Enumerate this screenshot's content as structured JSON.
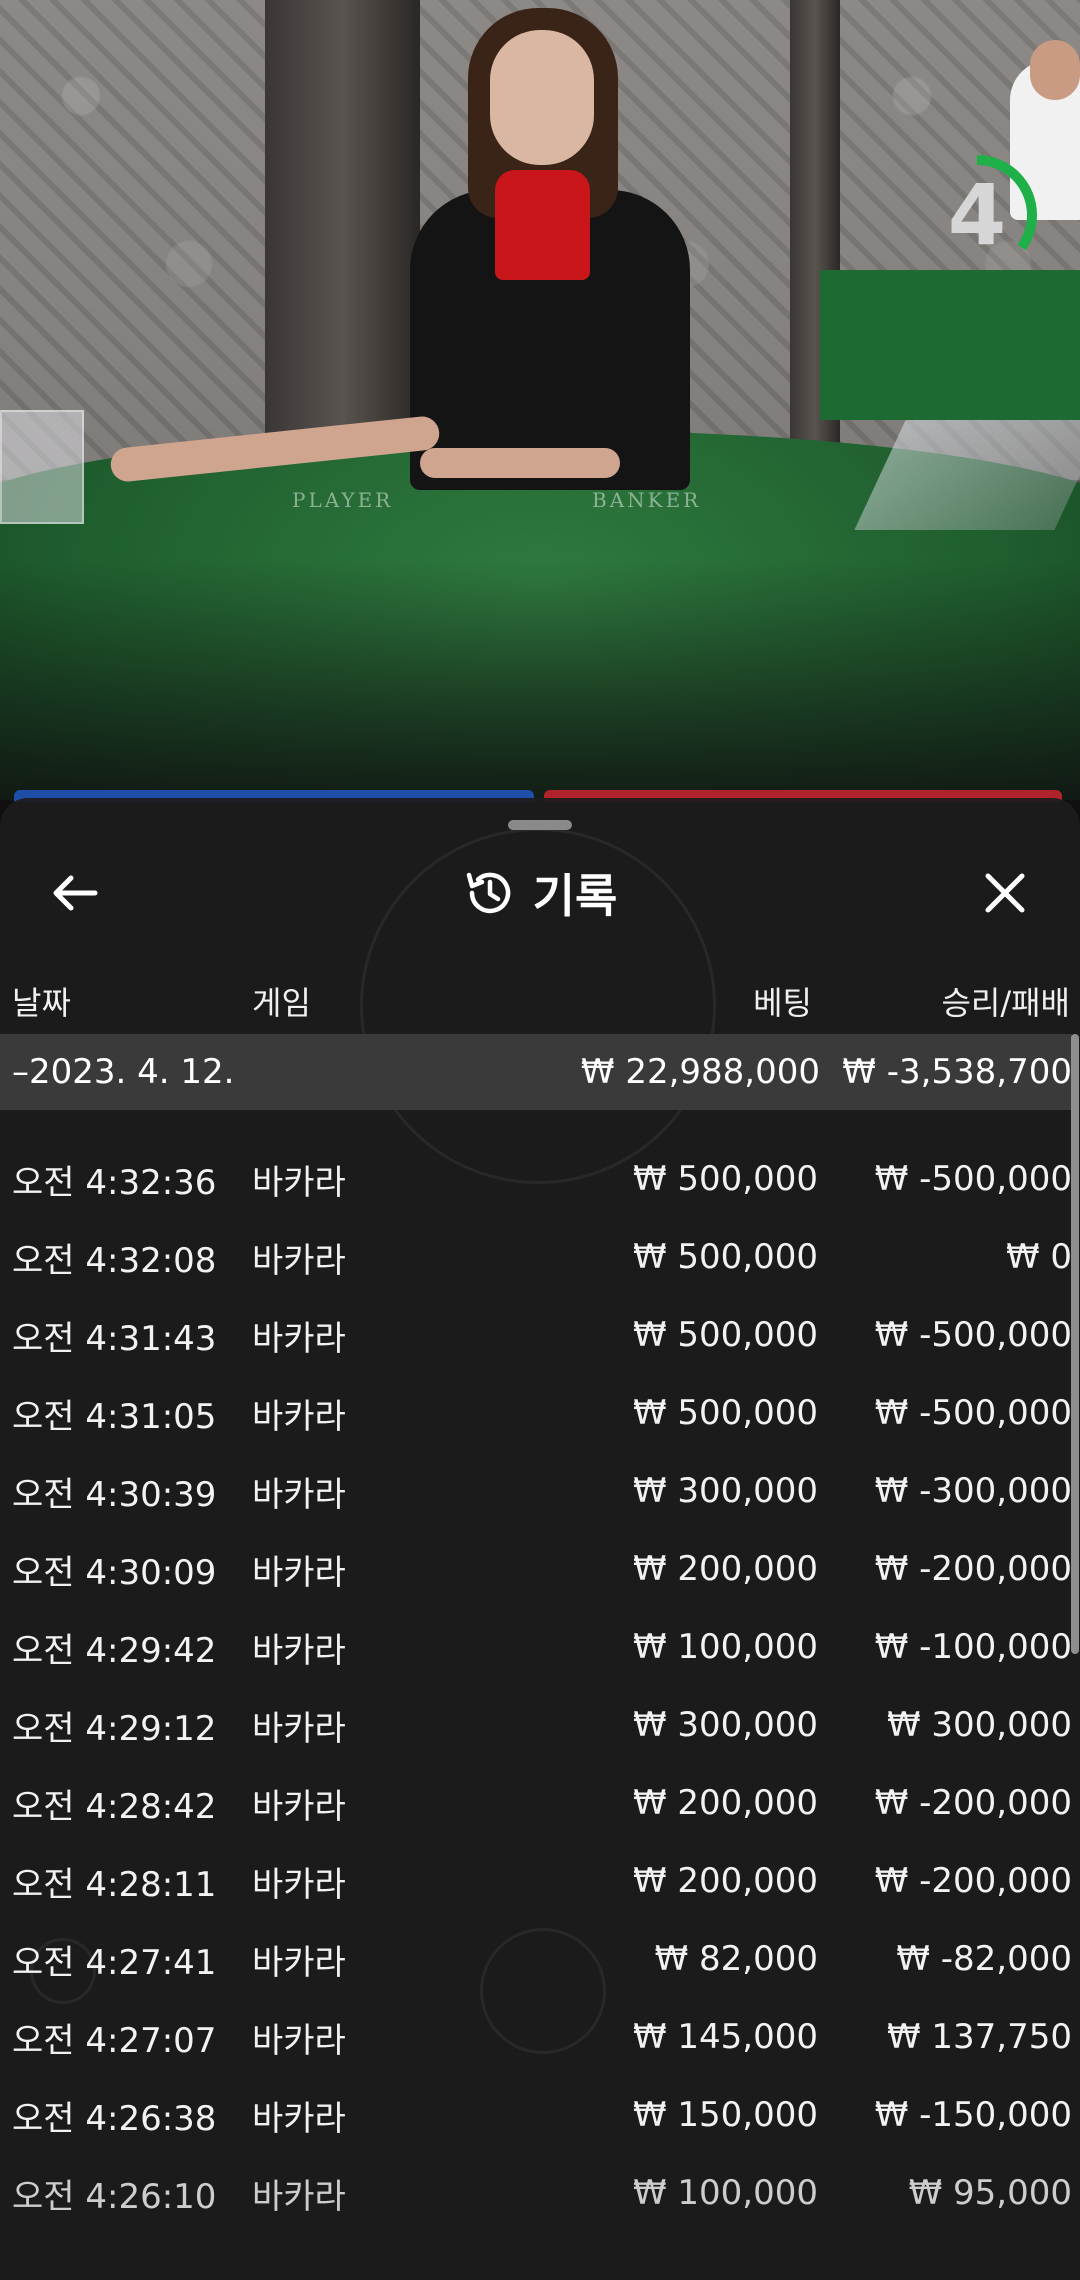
{
  "timer": {
    "value": "4",
    "progress": 0.35,
    "color": "#1fb04a"
  },
  "table": {
    "player_label": "PLAYER",
    "banker_label": "BANKER"
  },
  "colors": {
    "player": "#1e4ea8",
    "banker": "#b0232b",
    "summary_bg": "#3a3a3a"
  },
  "header": {
    "back_icon": "arrow-left-icon",
    "history_icon": "history-clock-icon",
    "title": "기록",
    "close_icon": "close-x-icon"
  },
  "columns": {
    "date": "날짜",
    "game": "게임",
    "bet": "베팅",
    "result": "승리/패배"
  },
  "summary": {
    "date": "–2023. 4. 12.",
    "bet": "₩ 22,988,000",
    "result": "₩ -3,538,700"
  },
  "rows": [
    {
      "time": "오전 4:32:36",
      "game": "바카라",
      "bet": "₩ 500,000",
      "result": "₩ -500,000"
    },
    {
      "time": "오전 4:32:08",
      "game": "바카라",
      "bet": "₩ 500,000",
      "result": "₩ 0"
    },
    {
      "time": "오전 4:31:43",
      "game": "바카라",
      "bet": "₩ 500,000",
      "result": "₩ -500,000"
    },
    {
      "time": "오전 4:31:05",
      "game": "바카라",
      "bet": "₩ 500,000",
      "result": "₩ -500,000"
    },
    {
      "time": "오전 4:30:39",
      "game": "바카라",
      "bet": "₩ 300,000",
      "result": "₩ -300,000"
    },
    {
      "time": "오전 4:30:09",
      "game": "바카라",
      "bet": "₩ 200,000",
      "result": "₩ -200,000"
    },
    {
      "time": "오전 4:29:42",
      "game": "바카라",
      "bet": "₩ 100,000",
      "result": "₩ -100,000"
    },
    {
      "time": "오전 4:29:12",
      "game": "바카라",
      "bet": "₩ 300,000",
      "result": "₩ 300,000"
    },
    {
      "time": "오전 4:28:42",
      "game": "바카라",
      "bet": "₩ 200,000",
      "result": "₩ -200,000"
    },
    {
      "time": "오전 4:28:11",
      "game": "바카라",
      "bet": "₩ 200,000",
      "result": "₩ -200,000"
    },
    {
      "time": "오전 4:27:41",
      "game": "바카라",
      "bet": "₩ 82,000",
      "result": "₩ -82,000"
    },
    {
      "time": "오전 4:27:07",
      "game": "바카라",
      "bet": "₩ 145,000",
      "result": "₩ 137,750"
    },
    {
      "time": "오전 4:26:38",
      "game": "바카라",
      "bet": "₩ 150,000",
      "result": "₩ -150,000"
    },
    {
      "time": "오전 4:26:10",
      "game": "바카라",
      "bet": "₩ 100,000",
      "result": "₩ 95,000"
    }
  ]
}
